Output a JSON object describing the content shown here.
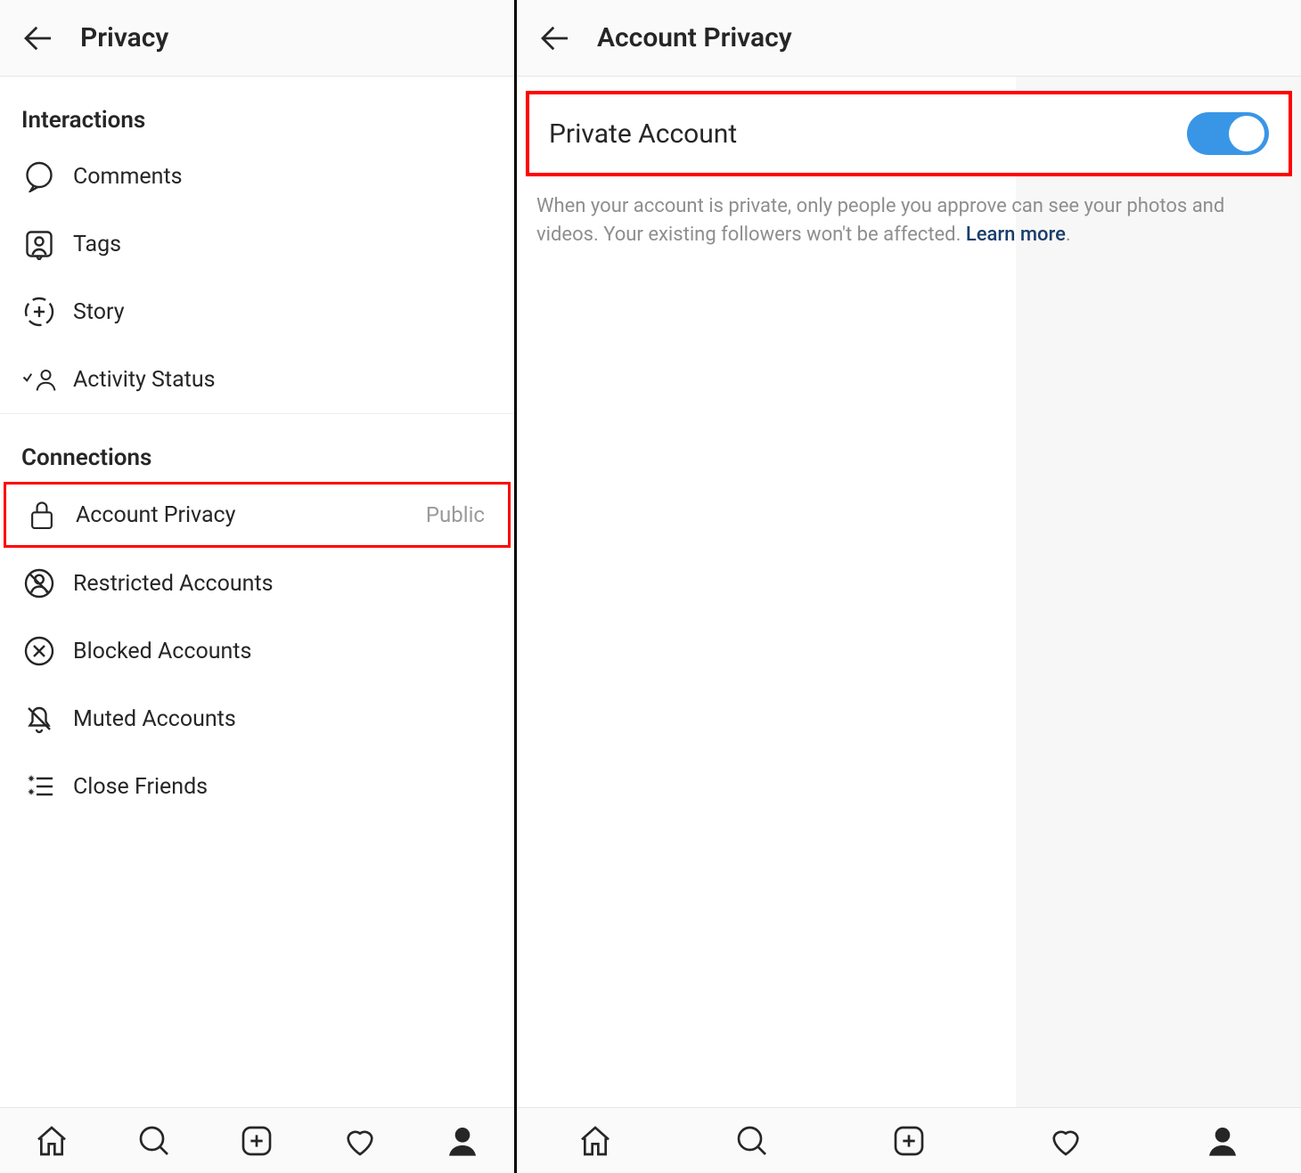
{
  "left": {
    "header_title": "Privacy",
    "sections": {
      "interactions": {
        "title": "Interactions",
        "items": [
          {
            "icon": "comment-icon",
            "label": "Comments"
          },
          {
            "icon": "tag-icon",
            "label": "Tags"
          },
          {
            "icon": "story-icon",
            "label": "Story"
          },
          {
            "icon": "activity-icon",
            "label": "Activity Status"
          }
        ]
      },
      "connections": {
        "title": "Connections",
        "items": [
          {
            "icon": "lock-icon",
            "label": "Account Privacy",
            "value": "Public",
            "highlight": true
          },
          {
            "icon": "restricted-icon",
            "label": "Restricted Accounts"
          },
          {
            "icon": "blocked-icon",
            "label": "Blocked Accounts"
          },
          {
            "icon": "muted-icon",
            "label": "Muted Accounts"
          },
          {
            "icon": "close-friends-icon",
            "label": "Close Friends"
          }
        ]
      }
    }
  },
  "right": {
    "header_title": "Account Privacy",
    "private_account_label": "Private Account",
    "private_account_on": true,
    "description": "When your account is private, only people you approve can see your photos and videos. Your existing followers won't be affected. ",
    "learn_more_label": "Learn more"
  },
  "colors": {
    "toggle_on": "#3996e6",
    "highlight_border": "#ff0000"
  }
}
